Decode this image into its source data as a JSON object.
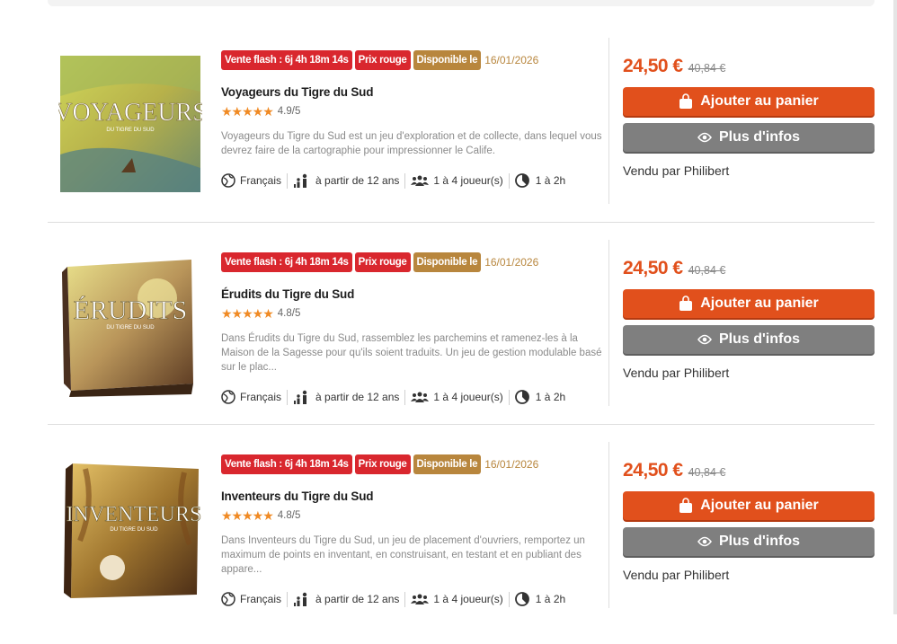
{
  "colors": {
    "accent": "#e1501c",
    "flash_badge": "#d9272e",
    "dispo_badge": "#b8863d",
    "info_button": "#7f7f7f",
    "stars": "#f08a24"
  },
  "products": [
    {
      "badge_flash": "Vente flash : 6j 4h 18m 14s",
      "badge_red": "Prix rouge",
      "badge_dispo": "Disponible le",
      "dispo_date": "16/01/2026",
      "title": "Voyageurs du Tigre du Sud",
      "stars": "★★★★★",
      "rating": "4.9/5",
      "description": "Voyageurs du Tigre du Sud est un jeu d'exploration et de collecte, dans lequel vous devrez faire de la cartographie pour impressionner le Calife.",
      "box_title": "VOYAGEURS",
      "box_subtitle": "DU TIGRE DU SUD",
      "language": "Français",
      "age": "à partir de 12 ans",
      "players": "1 à 4 joueur(s)",
      "duration": "1 à 2h",
      "price": "24,50 €",
      "old_price": "40,84 €",
      "cart_label": "Ajouter au panier",
      "info_label": "Plus d'infos",
      "seller": "Vendu par Philibert"
    },
    {
      "badge_flash": "Vente flash : 6j 4h 18m 14s",
      "badge_red": "Prix rouge",
      "badge_dispo": "Disponible le",
      "dispo_date": "16/01/2026",
      "title": "Érudits du Tigre du Sud",
      "stars": "★★★★★",
      "rating": "4.8/5",
      "description": "Dans Érudits du Tigre du Sud, rassemblez les parchemins et ramenez-les à la Maison de la Sagesse pour qu'ils soient traduits. Un jeu de gestion modulable basé sur le plac...",
      "box_title": "ÉRUDITS",
      "box_subtitle": "DU TIGRE DU SUD",
      "language": "Français",
      "age": "à partir de 12 ans",
      "players": "1 à 4 joueur(s)",
      "duration": "1 à 2h",
      "price": "24,50 €",
      "old_price": "40,84 €",
      "cart_label": "Ajouter au panier",
      "info_label": "Plus d'infos",
      "seller": "Vendu par Philibert"
    },
    {
      "badge_flash": "Vente flash : 6j 4h 18m 14s",
      "badge_red": "Prix rouge",
      "badge_dispo": "Disponible le",
      "dispo_date": "16/01/2026",
      "title": "Inventeurs du Tigre du Sud",
      "stars": "★★★★★",
      "rating": "4.8/5",
      "description": "Dans Inventeurs du Tigre du Sud, un jeu de placement d'ouvriers, remportez un maximum de points en inventant, en construisant, en testant et en publiant des appare...",
      "box_title": "INVENTEURS",
      "box_subtitle": "DU TIGRE DU SUD",
      "language": "Français",
      "age": "à partir de 12 ans",
      "players": "1 à 4 joueur(s)",
      "duration": "1 à 2h",
      "price": "24,50 €",
      "old_price": "40,84 €",
      "cart_label": "Ajouter au panier",
      "info_label": "Plus d'infos",
      "seller": "Vendu par Philibert"
    }
  ]
}
